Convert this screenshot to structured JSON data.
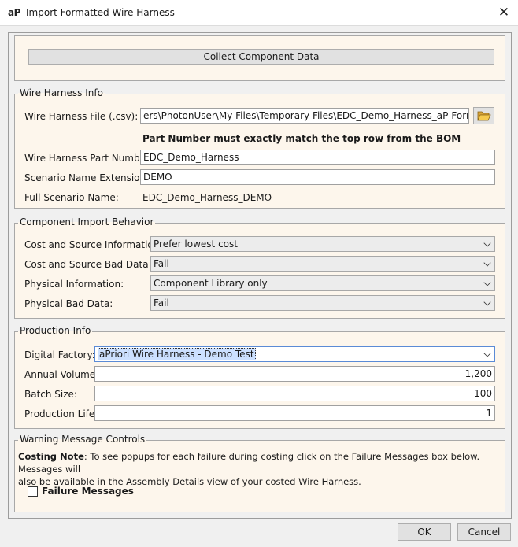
{
  "window": {
    "logo_text": "aP",
    "title": "Import Formatted Wire Harness",
    "close_glyph": "✕"
  },
  "collect_button": {
    "label": "Collect Component Data"
  },
  "wire_harness_info": {
    "legend": "Wire Harness Info",
    "file_label": "Wire Harness File (.csv):",
    "file_value": "ers\\PhotonUser\\My Files\\Temporary Files\\EDC_Demo_Harness_aP-Format.csv",
    "browse_icon": "folder-open-icon",
    "note": "Part Number must exactly match the top row from the BOM",
    "part_number_label": "Wire Harness Part Number:",
    "part_number_value": "EDC_Demo_Harness",
    "scenario_ext_label": "Scenario Name Extension:",
    "scenario_ext_value": "DEMO",
    "full_name_label": "Full Scenario Name:",
    "full_name_value": "EDC_Demo_Harness_DEMO"
  },
  "component_import": {
    "legend": "Component Import Behavior",
    "cost_source_label": "Cost and Source Information:",
    "cost_source_value": "Prefer lowest cost",
    "cost_bad_label": "Cost and Source Bad Data:",
    "cost_bad_value": "Fail",
    "physical_label": "Physical Information:",
    "physical_value": "Component Library only",
    "physical_bad_label": "Physical Bad Data:",
    "physical_bad_value": "Fail"
  },
  "production_info": {
    "legend": "Production Info",
    "factory_label": "Digital Factory:",
    "factory_value": "aPriori Wire Harness - Demo Test",
    "annual_label": "Annual Volume:",
    "annual_value": "1,200",
    "batch_label": "Batch Size:",
    "batch_value": "100",
    "life_label": "Production Life:",
    "life_value": "1"
  },
  "warning_controls": {
    "legend": "Warning Message Controls",
    "note_bold": "Costing Note",
    "note_line1": ": To see popups for each failure during costing click on the Failure Messages box below. Messages will",
    "note_line2": "also be available in the Assembly Details view of your costed Wire Harness.",
    "failure_label": "Failure Messages",
    "failure_checked": false
  },
  "footer": {
    "ok_label": "OK",
    "cancel_label": "Cancel"
  },
  "colors": {
    "panel_bg": "#fdf6ec",
    "client_bg": "#f0f0f0",
    "focus": "#5b8bd6"
  }
}
